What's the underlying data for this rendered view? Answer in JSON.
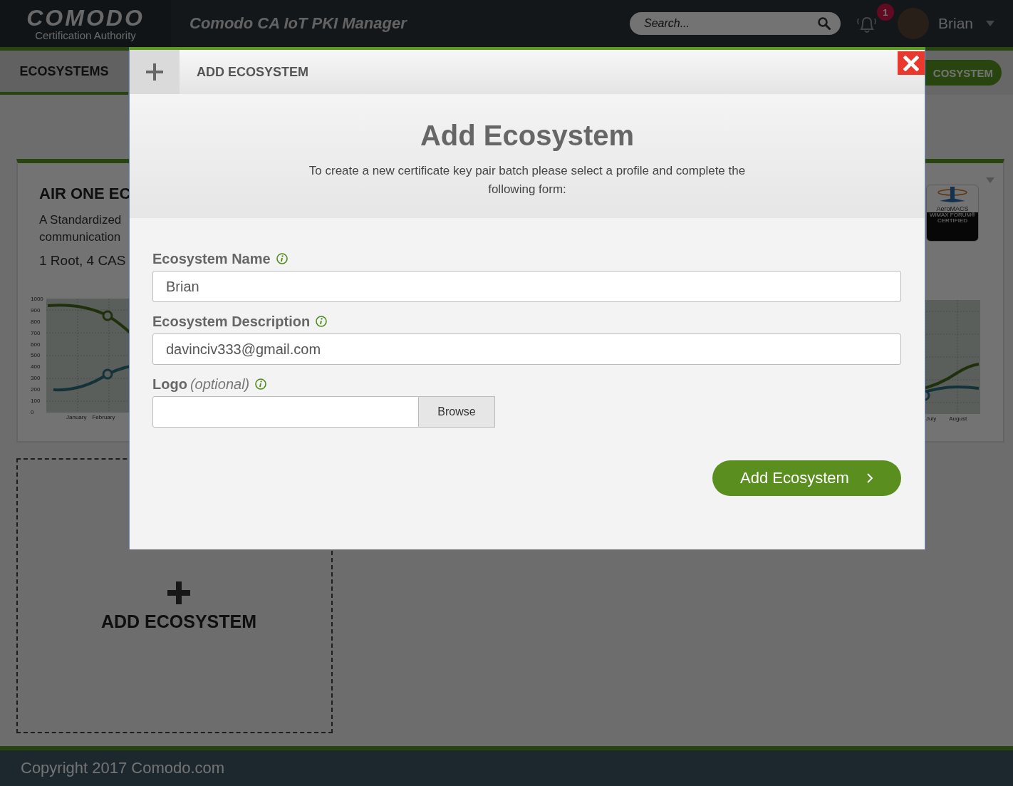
{
  "header": {
    "logo_title": "COMODO",
    "logo_subtitle": "Certification Authority",
    "app_title": "Comodo CA IoT PKI Manager",
    "search": {
      "placeholder": "Search..."
    },
    "notification_count": "1",
    "user_name": "Brian"
  },
  "subnav": {
    "tab": "ECOSYSTEMS",
    "action_button": "COSYSTEM"
  },
  "ecosystem_card": {
    "title": "AIR ONE EC",
    "description": "A Standardized communication",
    "summary": "1 Root, 4 CAS",
    "logo_texts": [
      "AeroMACS",
      "WiMAX FORUM® CERTIFIED"
    ],
    "y_ticks": [
      "1000",
      "900",
      "800",
      "700",
      "600",
      "500",
      "400",
      "300",
      "200",
      "100",
      "0"
    ],
    "x_labels_left": [
      "January",
      "February"
    ],
    "x_labels_right": [
      "July",
      "August"
    ]
  },
  "add_card": {
    "label": "ADD ECOSYSTEM"
  },
  "footer": "Copyright 2017 Comodo.com",
  "modal": {
    "tab_label": "ADD ECOSYSTEM",
    "title": "Add Ecosystem",
    "subtitle": "To create a new certificate key pair batch please select a profile and complete the following form:",
    "fields": [
      {
        "kind": "text",
        "label": "Ecosystem Name",
        "value": "Brian"
      },
      {
        "kind": "text",
        "label": "Ecosystem Description",
        "value": "davinciv333@gmail.com"
      },
      {
        "kind": "file",
        "label": "Logo",
        "note": "(optional)",
        "button": "Browse"
      }
    ],
    "submit": "Add Ecosystem"
  }
}
